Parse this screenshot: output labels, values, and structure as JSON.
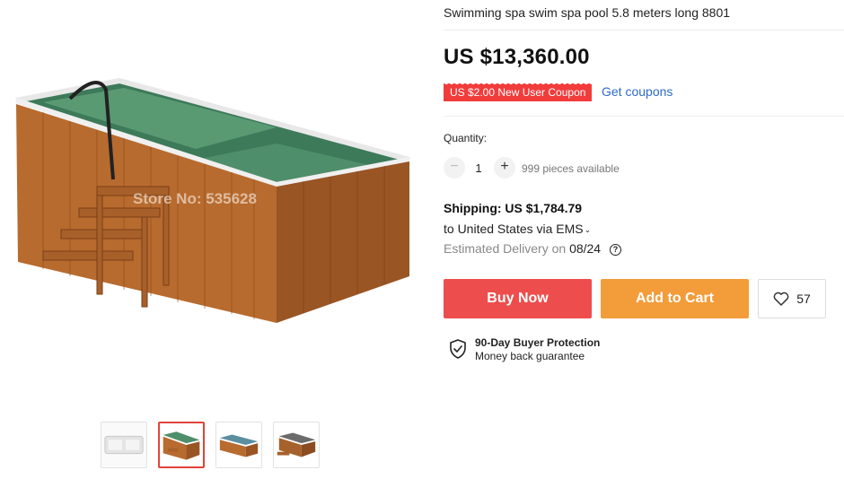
{
  "product": {
    "title": "Swimming spa swim spa pool 5.8 meters long 8801",
    "price": "US $13,360.00",
    "watermark": "Store No: 535628"
  },
  "coupon": {
    "badge": "US $2.00 New User Coupon",
    "link": "Get coupons"
  },
  "quantity": {
    "label": "Quantity:",
    "minus": "−",
    "value": "1",
    "plus": "+",
    "available": "999 pieces available"
  },
  "shipping": {
    "title": "Shipping: US $1,784.79",
    "destination": "to United States via EMS",
    "delivery_label": "Estimated Delivery on",
    "delivery_date": "08/24"
  },
  "actions": {
    "buy_now": "Buy Now",
    "add_to_cart": "Add to Cart",
    "wishlist_count": "57"
  },
  "protection": {
    "title": "90-Day Buyer Protection",
    "subtitle": "Money back guarantee"
  },
  "gallery": {
    "thumbnail_count": 4,
    "active_thumbnail": 2
  },
  "colors": {
    "buy_now": "#ee4d4d",
    "add_to_cart": "#f39c3a",
    "coupon": "#f23c3c",
    "link": "#2e6bc6"
  }
}
